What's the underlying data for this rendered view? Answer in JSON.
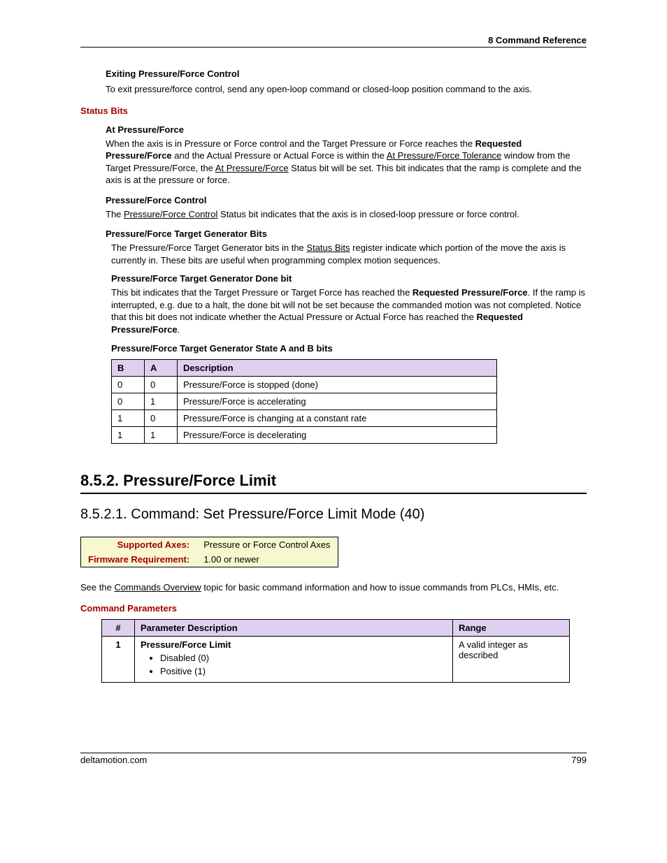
{
  "header": {
    "right": "8  Command Reference"
  },
  "footer": {
    "left": "deltamotion.com",
    "right": "799"
  },
  "exit": {
    "heading": "Exiting Pressure/Force Control",
    "text": "To exit pressure/force control, send any open-loop command or closed-loop position command to the axis."
  },
  "status": {
    "heading": "Status Bits",
    "atpf": {
      "heading": "At Pressure/Force",
      "p1a": "When the axis is in Pressure or Force control and the Target Pressure or Force reaches the ",
      "p1b": "Requested Pressure/Force",
      "p1c": " and the Actual Pressure or Actual Force is within the ",
      "p1d": "At Pressure/Force Tolerance",
      "p1e": " window from the Target Pressure/Force, the ",
      "p1f": "At Pressure/Force",
      "p1g": " Status bit will be set. This bit indicates that the ramp is complete and the axis is at the pressure or force."
    },
    "pfc": {
      "heading": "Pressure/Force Control",
      "p1a": "The ",
      "p1b": "Pressure/Force Control",
      "p1c": " Status bit indicates that the axis is in closed-loop pressure or force control."
    },
    "tgen": {
      "heading": "Pressure/Force Target Generator Bits",
      "p1a": "The Pressure/Force Target Generator bits in the ",
      "p1b": "Status Bits",
      "p1c": " register indicate which portion of the move the axis is currently in. These bits are useful when programming complex motion sequences."
    },
    "done": {
      "heading": "Pressure/Force Target Generator Done bit",
      "p1a": "This bit indicates that the Target Pressure or Target Force has reached the ",
      "p1b": "Requested Pressure/Force",
      "p1c": ". If the ramp is interrupted, e.g. due to a halt, the done bit will not be set because the commanded motion was not completed. Notice that this bit does not indicate whether the Actual Pressure or Actual Force has reached the ",
      "p1d": "Requested Pressure/Force",
      "p1e": "."
    },
    "statebits": {
      "heading": "Pressure/Force Target Generator State A and B bits",
      "headers": {
        "b": "B",
        "a": "A",
        "desc": "Description"
      },
      "rows": [
        {
          "b": "0",
          "a": "0",
          "desc": "Pressure/Force is stopped (done)"
        },
        {
          "b": "0",
          "a": "1",
          "desc": "Pressure/Force is accelerating"
        },
        {
          "b": "1",
          "a": "0",
          "desc": "Pressure/Force is changing at a constant rate"
        },
        {
          "b": "1",
          "a": "1",
          "desc": "Pressure/Force is decelerating"
        }
      ]
    }
  },
  "section852": {
    "title": "8.5.2. Pressure/Force Limit",
    "subtitle": "8.5.2.1. Command: Set Pressure/Force Limit Mode (40)",
    "meta": {
      "row1label": "Supported Axes:",
      "row1value": "Pressure or Force Control Axes",
      "row2label": "Firmware Requirement:",
      "row2value": "1.00 or newer"
    },
    "see": {
      "a": "See the ",
      "b": "Commands Overview",
      "c": " topic for basic command information and how to issue commands from PLCs, HMIs, etc."
    },
    "params": {
      "heading": "Command Parameters",
      "headers": {
        "num": "#",
        "desc": "Parameter Description",
        "range": "Range"
      },
      "row1": {
        "num": "1",
        "title": "Pressure/Force Limit",
        "bul1": "Disabled (0)",
        "bul2": "Positive (1)",
        "range": "A valid integer as described"
      }
    }
  }
}
